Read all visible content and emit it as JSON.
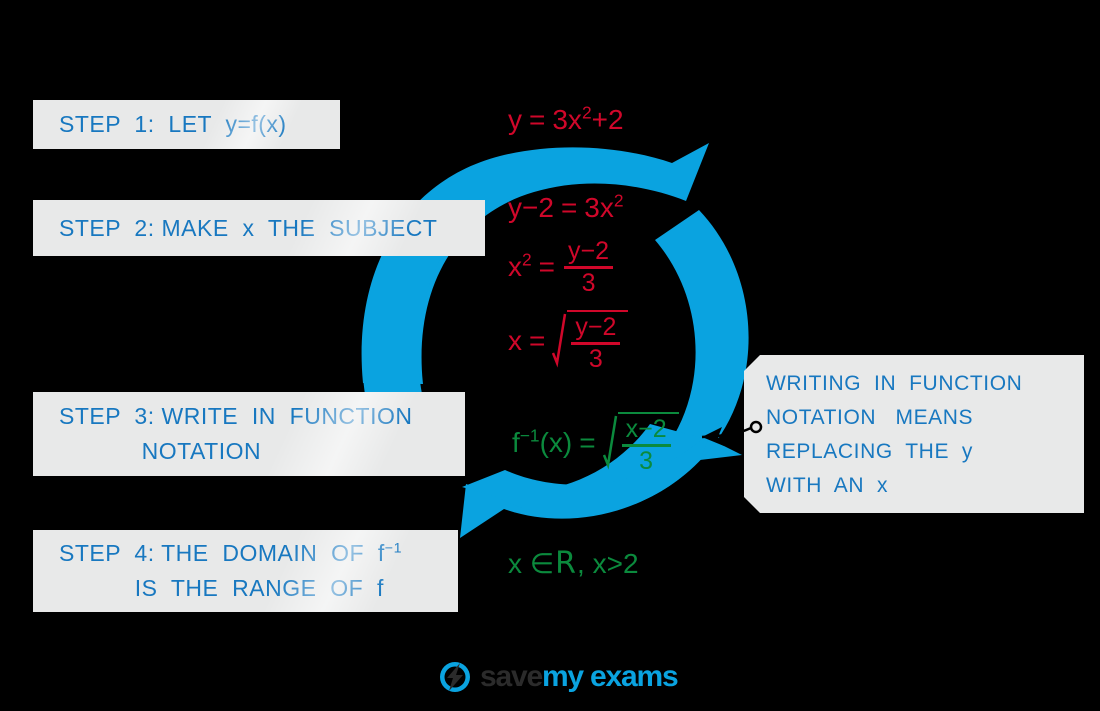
{
  "theme": {
    "background": "#000000",
    "accent_blue": "#0aa3e0",
    "text_blue": "#1878c0",
    "box_grey": "#e8e9e9",
    "red": "#d0072a",
    "green": "#0b8a3d"
  },
  "steps": [
    {
      "id": "step1",
      "lines": [
        "STEP  1:  LET  y=f(x)"
      ]
    },
    {
      "id": "step2",
      "lines": [
        "STEP  2: MAKE  x  THE  SUBJECT"
      ]
    },
    {
      "id": "step3",
      "lines": [
        "STEP  3: WRITE  IN  FUNCTION",
        "            NOTATION"
      ]
    },
    {
      "id": "step4",
      "lines": [
        "STEP  4: THE  DOMAIN  OF  f⁻¹",
        "           IS  THE  RANGE  OF  f"
      ]
    }
  ],
  "callout": {
    "lines": [
      "WRITING  IN  FUNCTION",
      "NOTATION   MEANS",
      "REPLACING  THE  y",
      "WITH  AN  x"
    ]
  },
  "equations": {
    "eq1": {
      "lhs": "y",
      "rel": "=",
      "rhs": "3x²+2",
      "color": "red"
    },
    "eq2": {
      "lhs": "y−2",
      "rel": "=",
      "rhs": "3x²",
      "color": "red"
    },
    "eq3": {
      "lhs": "x²",
      "rel": "=",
      "numerator": "y−2",
      "denominator": "3",
      "color": "red"
    },
    "eq4": {
      "lhs": "x",
      "rel": "=",
      "radical": true,
      "numerator": "y−2",
      "denominator": "3",
      "color": "red"
    },
    "eq5": {
      "lhs": "f⁻¹(x)",
      "rel": "=",
      "radical": true,
      "numerator": "x−2",
      "denominator": "3",
      "color": "green"
    },
    "eq6": {
      "text_a": "x ∈",
      "set": "R",
      "text_b": ",  x>2",
      "color": "green"
    }
  },
  "logo": {
    "icon": "lightning-bolt-circle-icon",
    "word_1": "save",
    "word_2": "my exams"
  },
  "cycle_arrow": {
    "name": "circular-cycle-arrow",
    "color": "#0aa3e0",
    "segments": 2
  }
}
